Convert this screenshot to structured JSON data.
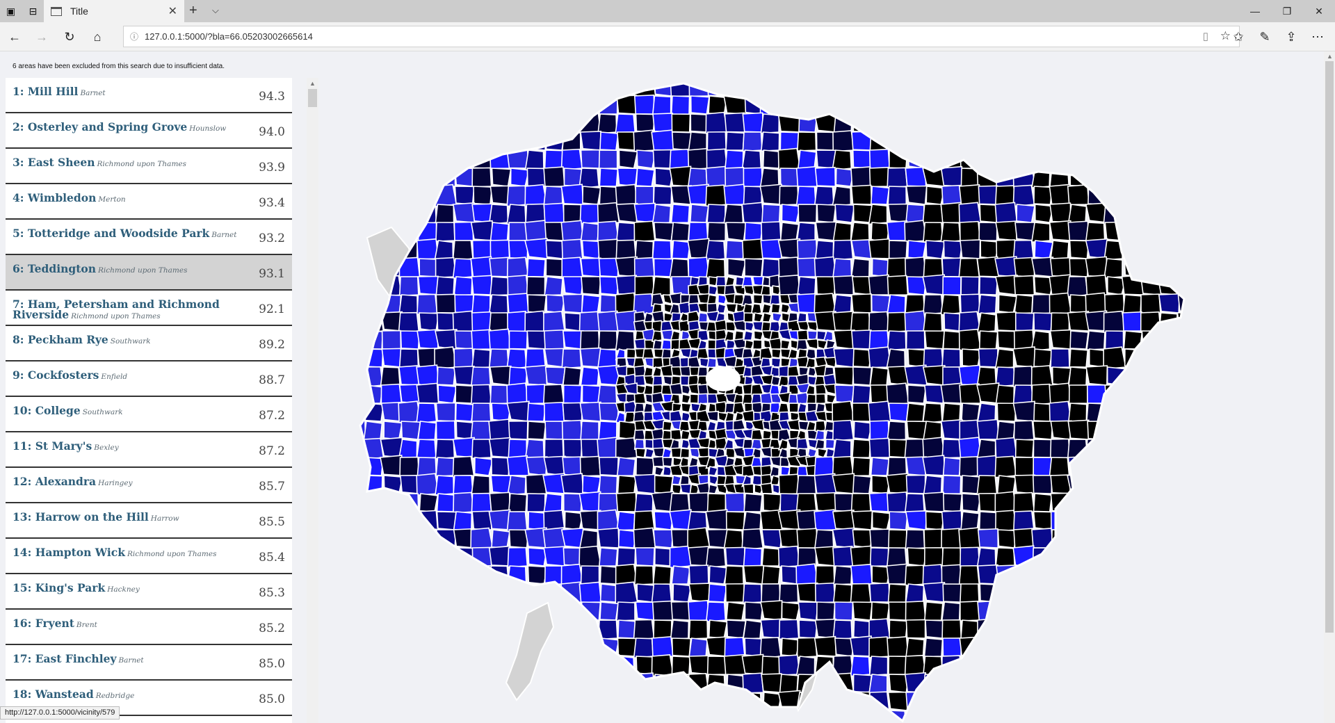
{
  "window": {
    "tab_title": "Title",
    "new_tab_glyph": "+",
    "tab_close_glyph": "✕",
    "tab_menu_glyph": "⌵"
  },
  "nav": {
    "url": "127.0.0.1:5000/?bla=66.05203002665614",
    "icons": [
      "back-icon",
      "forward-icon",
      "refresh-icon",
      "home-icon",
      "info-icon",
      "reading-view-icon",
      "favorite-star-icon",
      "favorites-icon",
      "notes-icon",
      "share-icon",
      "more-icon"
    ]
  },
  "notice": "6 areas have been excluded from this search due to insufficient data.",
  "results": [
    {
      "rank_name": "1: Mill Hill",
      "borough": "Barnet",
      "score": "94.3"
    },
    {
      "rank_name": "2: Osterley and Spring Grove",
      "borough": "Hounslow",
      "score": "94.0"
    },
    {
      "rank_name": "3: East Sheen",
      "borough": "Richmond upon Thames",
      "score": "93.9"
    },
    {
      "rank_name": "4: Wimbledon",
      "borough": "Merton",
      "score": "93.4"
    },
    {
      "rank_name": "5: Totteridge and Woodside Park",
      "borough": "Barnet",
      "score": "93.2"
    },
    {
      "rank_name": "6: Teddington",
      "borough": "Richmond upon Thames",
      "score": "93.1"
    },
    {
      "rank_name": "7: Ham, Petersham and Richmond Riverside",
      "borough": "Richmond upon Thames",
      "score": "92.1"
    },
    {
      "rank_name": "8: Peckham Rye",
      "borough": "Southwark",
      "score": "89.2"
    },
    {
      "rank_name": "9: Cockfosters",
      "borough": "Enfield",
      "score": "88.7"
    },
    {
      "rank_name": "10: College",
      "borough": "Southwark",
      "score": "87.2"
    },
    {
      "rank_name": "11: St Mary's",
      "borough": "Bexley",
      "score": "87.2"
    },
    {
      "rank_name": "12: Alexandra",
      "borough": "Haringey",
      "score": "85.7"
    },
    {
      "rank_name": "13: Harrow on the Hill",
      "borough": "Harrow",
      "score": "85.5"
    },
    {
      "rank_name": "14: Hampton Wick",
      "borough": "Richmond upon Thames",
      "score": "85.4"
    },
    {
      "rank_name": "15: King's Park",
      "borough": "Hackney",
      "score": "85.3"
    },
    {
      "rank_name": "16: Fryent",
      "borough": "Brent",
      "score": "85.2"
    },
    {
      "rank_name": "17: East Finchley",
      "borough": "Barnet",
      "score": "85.0"
    },
    {
      "rank_name": "18: Wanstead",
      "borough": "Redbridge",
      "score": "85.0"
    }
  ],
  "selected_rank": 6,
  "status_url": "http://127.0.0.1:5000/vicinity/579",
  "map": {
    "colors": {
      "high": "#1a1aff",
      "mid": "#0a0a8c",
      "low": "#000000",
      "excluded": "#d3d3d3",
      "border": "#ffffff"
    }
  }
}
